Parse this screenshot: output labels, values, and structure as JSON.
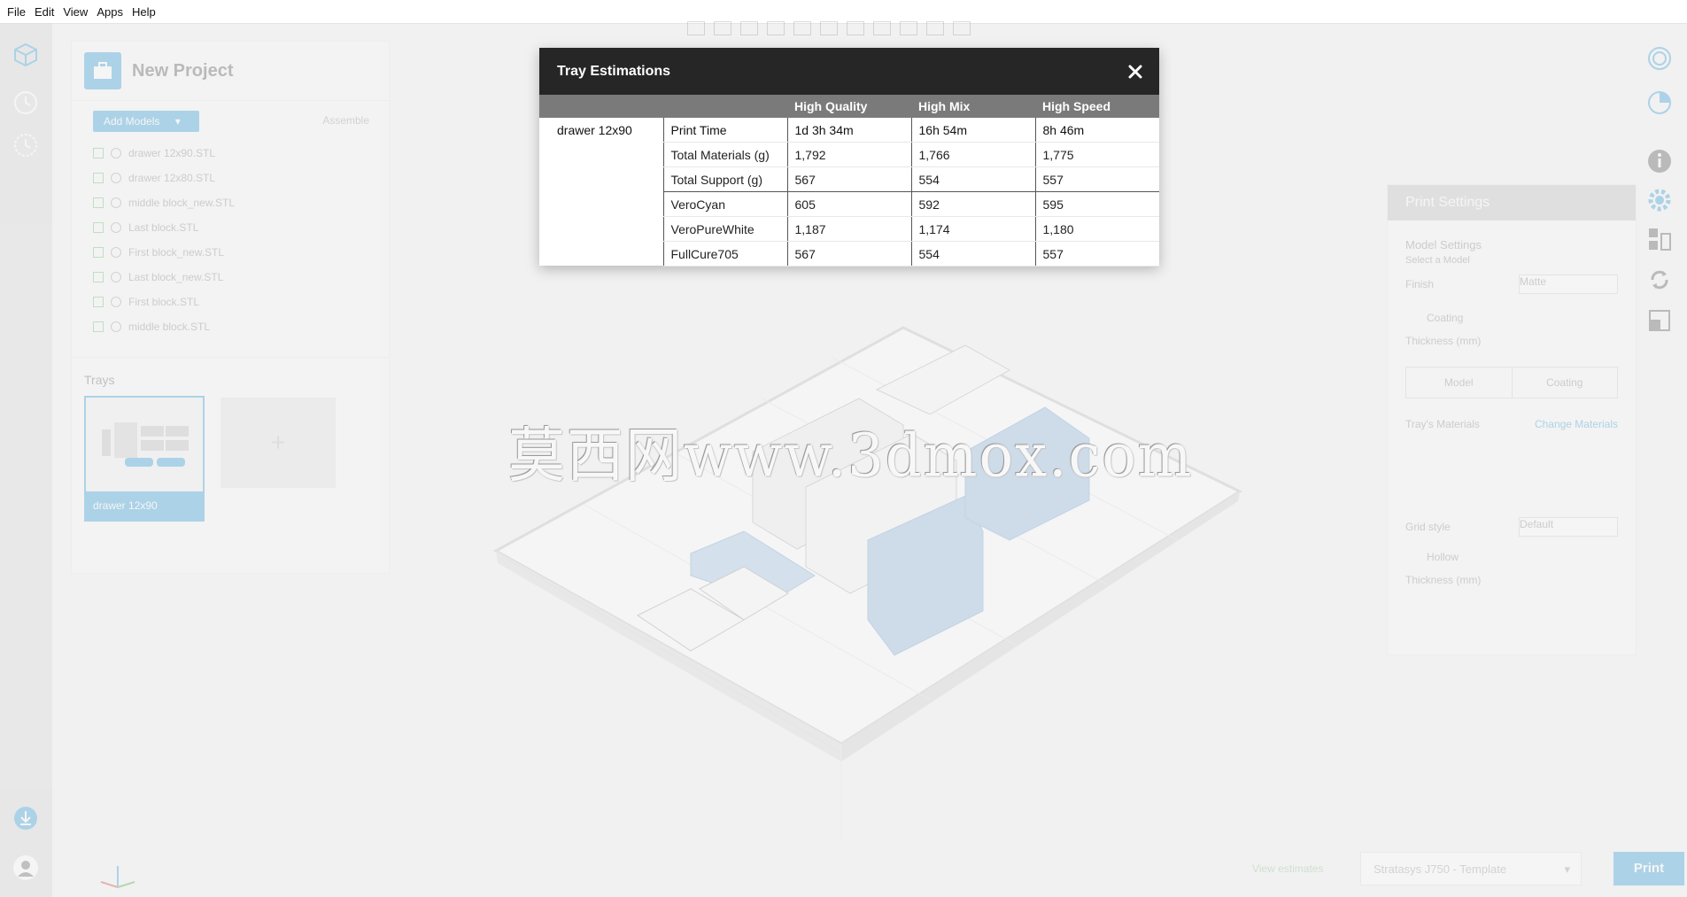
{
  "menu": [
    "File",
    "Edit",
    "View",
    "Apps",
    "Help"
  ],
  "project": {
    "title": "New Project",
    "add_models_label": "Add Models",
    "assemble_label": "Assemble",
    "models": [
      "drawer 12x90.STL",
      "drawer 12x80.STL",
      "middle block_new.STL",
      "Last block.STL",
      "First block_new.STL",
      "Last block_new.STL",
      "First block.STL",
      "middle block.STL"
    ],
    "trays_label": "Trays",
    "tray_name": "drawer 12x90",
    "add_tray_symbol": "+"
  },
  "print_settings": {
    "title": "Print Settings",
    "model_settings": "Model Settings",
    "select_model": "Select a Model",
    "finish_label": "Finish",
    "finish_value": "Matte",
    "coating_label": "Coating",
    "thickness_label": "Thickness (mm)",
    "tab_model": "Model",
    "tab_coating": "Coating",
    "tray_materials_label": "Tray's Materials",
    "change_materials": "Change Materials",
    "grid_style_label": "Grid style",
    "grid_style_value": "Default",
    "hollow_label": "Hollow",
    "thickness2_label": "Thickness (mm)"
  },
  "bottom": {
    "view_estimates": "View estimates",
    "printer": "Stratasys J750 - Template",
    "print_label": "Print"
  },
  "watermark": "莫西网www.3dmox.com",
  "dialog": {
    "title": "Tray Estimations",
    "close_icon": "close-icon",
    "columns": [
      "",
      "",
      "High Quality",
      "High Mix",
      "High Speed"
    ],
    "model": "drawer 12x90",
    "rows": [
      {
        "label": "Print Time",
        "values": [
          "1d 3h 34m",
          "16h 54m",
          "8h 46m"
        ]
      },
      {
        "label": "Total Materials (g)",
        "values": [
          "1,792",
          "1,766",
          "1,775"
        ]
      },
      {
        "label": "Total Support (g)",
        "values": [
          "567",
          "554",
          "557"
        ]
      },
      {
        "label": "VeroCyan",
        "values": [
          "605",
          "592",
          "595"
        ]
      },
      {
        "label": "VeroPureWhite",
        "values": [
          "1,187",
          "1,174",
          "1,180"
        ]
      },
      {
        "label": "FullCure705",
        "values": [
          "567",
          "554",
          "557"
        ]
      }
    ]
  },
  "colors": {
    "accent": "#2f9ad6",
    "dialog_header": "#262626",
    "table_header": "#7a7a7a"
  }
}
